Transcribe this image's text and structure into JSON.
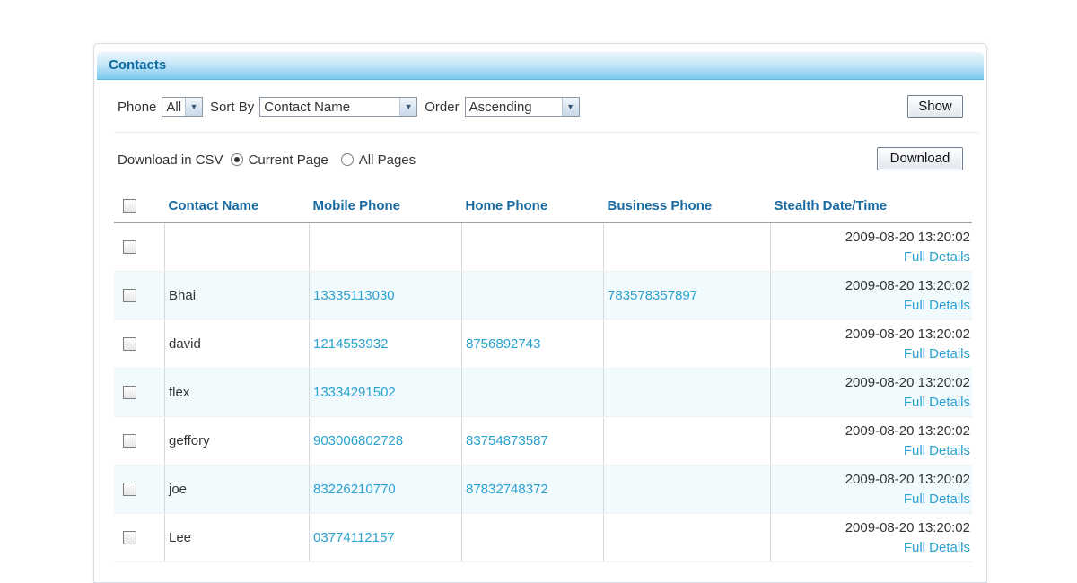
{
  "panel": {
    "title": "Contacts"
  },
  "filters": {
    "phone_label": "Phone",
    "phone_value": "All",
    "sortby_label": "Sort By",
    "sortby_value": "Contact Name",
    "order_label": "Order",
    "order_value": "Ascending",
    "show_label": "Show"
  },
  "download": {
    "label": "Download in CSV",
    "current_page": "Current Page",
    "all_pages": "All Pages",
    "selected": "current_page",
    "button": "Download"
  },
  "table": {
    "headers": [
      "Contact Name",
      "Mobile Phone",
      "Home Phone",
      "Business Phone",
      "Stealth Date/Time"
    ],
    "details_label": "Full Details",
    "rows": [
      {
        "name": "",
        "mobile": "",
        "home": "",
        "business": "",
        "datetime": "2009-08-20 13:20:02"
      },
      {
        "name": "Bhai",
        "mobile": "13335113030",
        "home": "",
        "business": "783578357897",
        "datetime": "2009-08-20 13:20:02"
      },
      {
        "name": "david",
        "mobile": "1214553932",
        "home": "8756892743",
        "business": "",
        "datetime": "2009-08-20 13:20:02"
      },
      {
        "name": "flex",
        "mobile": "13334291502",
        "home": "",
        "business": "",
        "datetime": "2009-08-20 13:20:02"
      },
      {
        "name": "geffory",
        "mobile": "903006802728",
        "home": "83754873587",
        "business": "",
        "datetime": "2009-08-20 13:20:02"
      },
      {
        "name": "joe",
        "mobile": "83226210770",
        "home": "87832748372",
        "business": "",
        "datetime": "2009-08-20 13:20:02"
      },
      {
        "name": "Lee",
        "mobile": "03774112157",
        "home": "",
        "business": "",
        "datetime": "2009-08-20 13:20:02"
      }
    ]
  },
  "colors": {
    "accent": "#1a6aa0",
    "link": "#2aa1cf",
    "title_bar": "#7ccaf0"
  }
}
